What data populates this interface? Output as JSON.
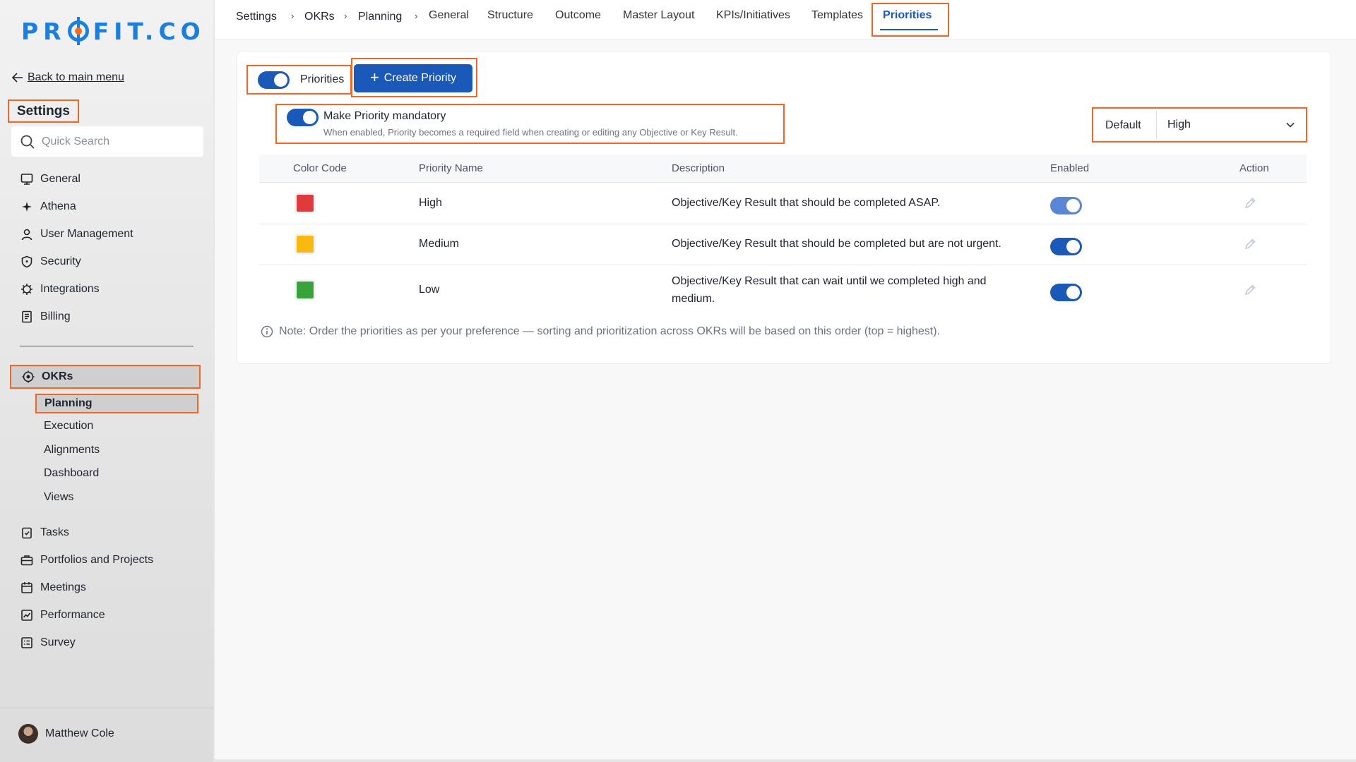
{
  "brand": {
    "logo_left": "PR",
    "logo_right": "FIT.CO",
    "accent": "#1b7fe0",
    "highlight": "#f26522"
  },
  "sidebar": {
    "back_label": "Back to main menu",
    "title": "Settings",
    "search_placeholder": "Quick Search",
    "items": [
      {
        "label": "General",
        "icon": "monitor-icon"
      },
      {
        "label": "Athena",
        "icon": "sparkle-icon"
      },
      {
        "label": "User Management",
        "icon": "user-icon"
      },
      {
        "label": "Security",
        "icon": "shield-icon"
      },
      {
        "label": "Integrations",
        "icon": "gear-icon"
      },
      {
        "label": "Billing",
        "icon": "receipt-icon"
      }
    ],
    "okrs": {
      "label": "OKRs",
      "sub_items": [
        "Planning",
        "Execution",
        "Alignments",
        "Dashboard",
        "Views"
      ]
    },
    "items2": [
      {
        "label": "Tasks",
        "icon": "clipboard-check-icon"
      },
      {
        "label": "Portfolios and Projects",
        "icon": "briefcase-icon"
      },
      {
        "label": "Meetings",
        "icon": "calendar-icon"
      },
      {
        "label": "Performance",
        "icon": "chart-icon"
      },
      {
        "label": "Survey",
        "icon": "list-icon"
      }
    ],
    "user_name": "Matthew Cole"
  },
  "topbar": {
    "breadcrumb": [
      "Settings",
      "OKRs",
      "Planning"
    ],
    "tabs": [
      "General",
      "Structure",
      "Outcome",
      "Master Layout",
      "KPIs/Initiatives",
      "Templates"
    ],
    "active_tab": "Priorities"
  },
  "controls": {
    "priorities_label": "Priorities",
    "priorities_enabled": true,
    "create_label": "Create Priority",
    "mandatory_title": "Make Priority mandatory",
    "mandatory_sub": "When enabled, Priority becomes a required field when creating or editing any Objective or Key Result.",
    "mandatory_enabled": true,
    "default_label": "Default",
    "default_value": "High"
  },
  "table": {
    "headers": [
      "Color Code",
      "Priority Name",
      "Description",
      "Enabled",
      "Action"
    ],
    "rows": [
      {
        "color": "#e03a3e",
        "name": "High",
        "description": "Objective/Key Result that should be completed ASAP.",
        "enabled": true
      },
      {
        "color": "#f9b90f",
        "name": "Medium",
        "description": "Objective/Key Result that should be completed but are not urgent.",
        "enabled": true
      },
      {
        "color": "#39a33b",
        "name": "Low",
        "description": "Objective/Key Result that can wait until we completed high and medium.",
        "enabled": true
      }
    ]
  },
  "note": "Note: Order the priorities as per your preference — sorting and prioritization across OKRs will be based on this order (top = highest)."
}
